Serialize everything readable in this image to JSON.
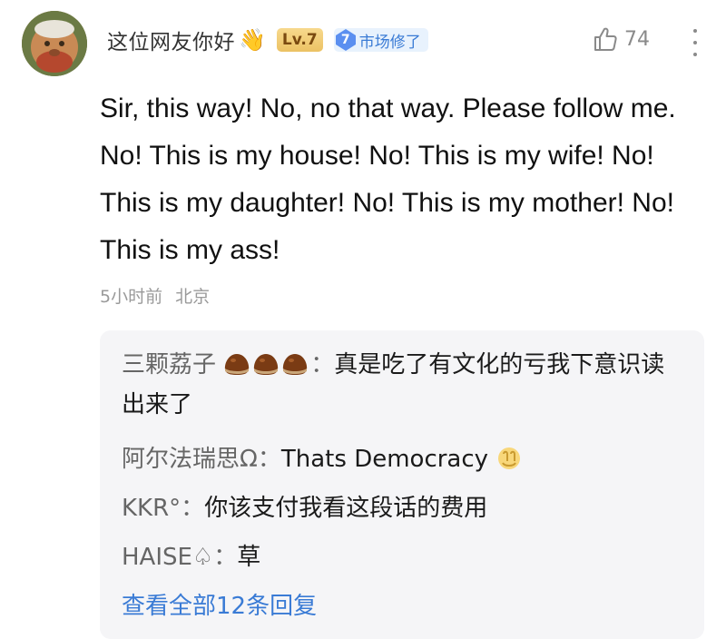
{
  "user": {
    "name": "这位网友你好",
    "name_emoji": "👋",
    "level": "Lv.7",
    "tag_number": "7",
    "tag_label": "市场修了"
  },
  "actions": {
    "like_count": "74",
    "like_icon": "thumbs-up-icon",
    "more_icon": "more-vertical-icon"
  },
  "comment": {
    "text": "Sir, this way! No, no that way. Please follow me. No! This is my house! No! This is my wife! No! This is my daughter! No! This is my mother! No! This is my ass!",
    "time": "5小时前",
    "location": "北京"
  },
  "replies": [
    {
      "name": "三颗荔子",
      "separator": "：",
      "text": "真是吃了有文化的亏我下意识读出来了"
    },
    {
      "name": "阿尔法瑞思Ω",
      "separator": "：",
      "text": "Thats Democracy"
    },
    {
      "name": "KKR°",
      "separator": "：",
      "text": "你该支付我看这段话的费用"
    },
    {
      "name": "HAISE♤",
      "separator": "：",
      "text": "草"
    }
  ],
  "view_all": "查看全部12条回复",
  "colors": {
    "accent": "#3a7bd5",
    "reply_bg": "#f5f5f7",
    "meta": "#9a9a9a"
  }
}
